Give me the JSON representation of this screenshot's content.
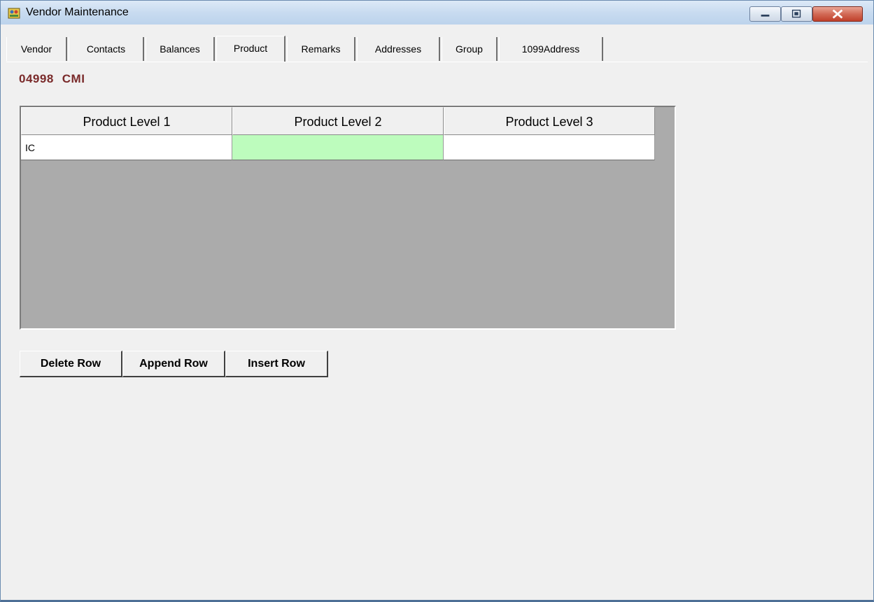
{
  "window": {
    "title": "Vendor Maintenance",
    "icon": "vendor-app-icon",
    "controls": [
      "minimize-icon",
      "restore-icon",
      "close-icon"
    ]
  },
  "tabs": [
    {
      "label": "Vendor"
    },
    {
      "label": "Contacts"
    },
    {
      "label": "Balances"
    },
    {
      "label": "Product",
      "active": true
    },
    {
      "label": "Remarks"
    },
    {
      "label": "Addresses"
    },
    {
      "label": "Group"
    },
    {
      "label": "1099Address"
    }
  ],
  "vendor": {
    "id": "04998",
    "name": "CMI"
  },
  "grid": {
    "columns": [
      "Product Level 1",
      "Product Level 2",
      "Product Level 3"
    ],
    "rows": [
      [
        "IC",
        "",
        ""
      ]
    ],
    "current_cell_color": "#bdfcbd"
  },
  "buttons": {
    "delete_row": "Delete Row",
    "append_row": "Append Row",
    "insert_row": "Insert Row"
  }
}
